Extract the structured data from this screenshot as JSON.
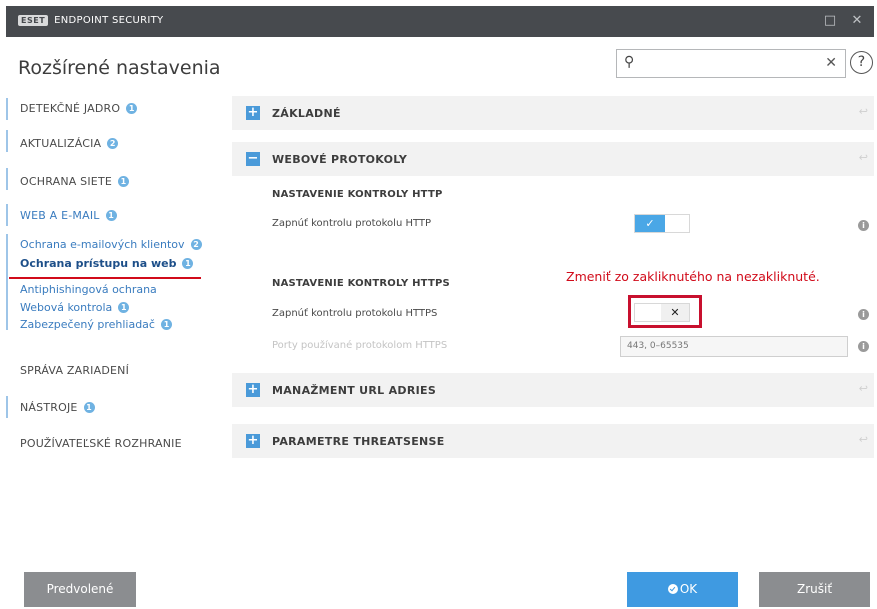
{
  "titlebar": {
    "logo": "ESET",
    "product": "ENDPOINT SECURITY",
    "maximize_glyph": "□",
    "close_glyph": "✕"
  },
  "header": {
    "title": "Rozšírené nastavenia",
    "search": {
      "value": "",
      "placeholder": ""
    },
    "help_glyph": "?"
  },
  "sidebar": {
    "items": [
      {
        "label": "DETEKČNÉ JADRO",
        "badge": "1"
      },
      {
        "label": "AKTUALIZÁCIA",
        "badge": "2"
      },
      {
        "label": "OCHRANA SIETE",
        "badge": "1"
      },
      {
        "label": "WEB A E-MAIL",
        "badge": "1"
      },
      {
        "label": "SPRÁVA ZARIADENÍ"
      },
      {
        "label": "NÁSTROJE",
        "badge": "1"
      },
      {
        "label": "POUŽÍVATEĽSKÉ ROZHRANIE"
      }
    ],
    "subitems": [
      {
        "label": "Ochrana e-mailových klientov",
        "badge": "2"
      },
      {
        "label": "Ochrana prístupu na web",
        "badge": "1"
      },
      {
        "label": "Antiphishingová ochrana"
      },
      {
        "label": "Webová kontrola",
        "badge": "1"
      },
      {
        "label": "Zabezpečený prehliadač",
        "badge": "1"
      }
    ]
  },
  "main": {
    "sections": [
      {
        "title": "ZÁKLADNÉ",
        "glyph": "+"
      },
      {
        "title": "WEBOVÉ PROTOKOLY",
        "glyph": "−"
      },
      {
        "title": "MANAŽMENT URL ADRIES",
        "glyph": "+"
      },
      {
        "title": "PARAMETRE THREATSENSE",
        "glyph": "+"
      }
    ],
    "http": {
      "heading": "NASTAVENIE KONTROLY HTTP",
      "label": "Zapnúť kontrolu protokolu HTTP",
      "enabled": true,
      "on_glyph": "✓"
    },
    "https": {
      "heading": "NASTAVENIE KONTROLY HTTPS",
      "label": "Zapnúť kontrolu protokolu HTTPS",
      "enabled": false,
      "off_glyph": "✕",
      "ports_label": "Porty používané protokolom HTTPS",
      "ports_value": "443, 0–65535"
    },
    "annotation": "Zmeniť zo zakliknutého na nezakliknuté.",
    "info_glyph": "i",
    "revert_glyph": "↩"
  },
  "buttons": {
    "default": "Predvolené",
    "ok": "OK",
    "cancel": "Zrušiť"
  },
  "colors": {
    "accent": "#3f9ae1",
    "annotation_red": "#d10b1a",
    "titlebar": "#474a4e"
  }
}
